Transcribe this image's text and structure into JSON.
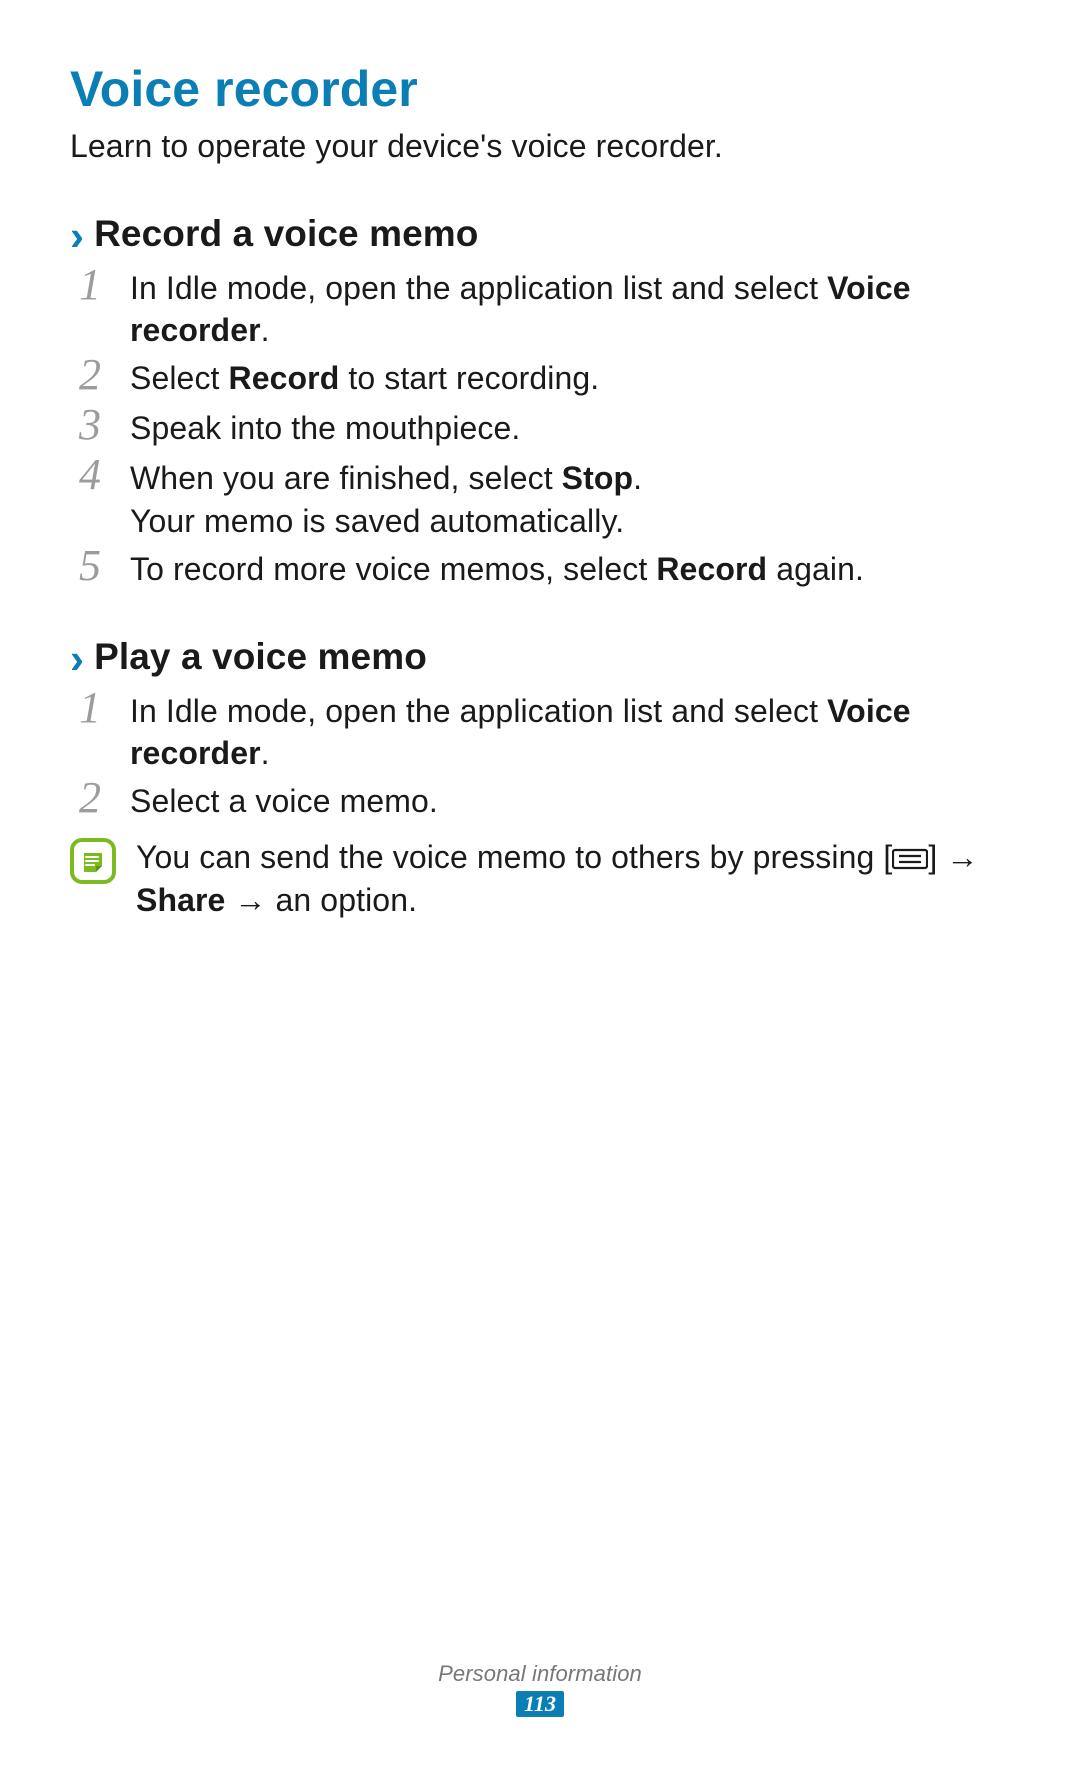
{
  "title": "Voice recorder",
  "intro": "Learn to operate your device's voice recorder.",
  "section1": {
    "title": "Record a voice memo",
    "steps": {
      "s1a": "In Idle mode, open the application list and select ",
      "s1b": "Voice recorder",
      "s1c": ".",
      "s2a": "Select ",
      "s2b": "Record",
      "s2c": " to start recording.",
      "s3": "Speak into the mouthpiece.",
      "s4a": "When you are finished, select ",
      "s4b": "Stop",
      "s4c": ".",
      "s4d": "Your memo is saved automatically.",
      "s5a": "To record more voice memos, select ",
      "s5b": "Record",
      "s5c": " again."
    }
  },
  "section2": {
    "title": "Play a voice memo",
    "steps": {
      "s1a": "In Idle mode, open the application list and select ",
      "s1b": "Voice recorder",
      "s1c": ".",
      "s2": "Select a voice memo."
    },
    "tip": {
      "a": "You can send the voice memo to others by pressing [",
      "b": "] → ",
      "c": "Share",
      "d": " → an option."
    }
  },
  "nums": {
    "n1": "1",
    "n2": "2",
    "n3": "3",
    "n4": "4",
    "n5": "5"
  },
  "footer": {
    "category": "Personal information",
    "page": "113"
  }
}
